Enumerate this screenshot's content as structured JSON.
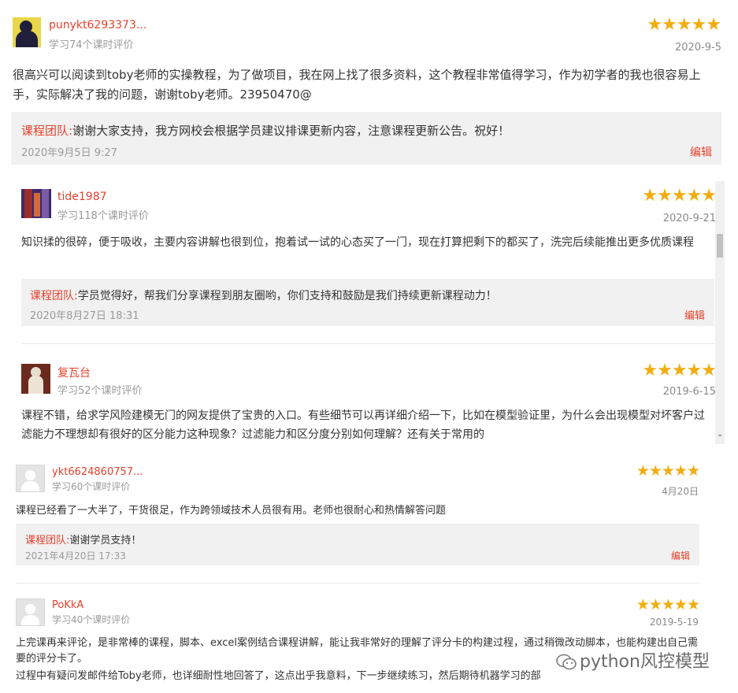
{
  "reviews": [
    {
      "user": "punykt6293373...",
      "meta": "学习74个课时评价",
      "stars": "★★★★★",
      "date": "2020-9-5",
      "content": "很高兴可以阅读到toby老师的实操教程，为了做项目，我在网上找了很多资料，这个教程非常值得学习，作为初学者的我也很容易上手，实际解决了我的问题，谢谢toby老师。23950470@",
      "reply": {
        "team": "课程团队",
        "text": "谢谢大家支持，我方网校会根据学员建议排课更新内容，注意课程更新公告。祝好！",
        "date": "2020年9月5日 9:27",
        "edit": "编辑"
      }
    },
    {
      "user": "tide1987",
      "meta": "学习118个课时评价",
      "stars": "★★★★★",
      "date": "2020-9-21",
      "content": "知识揉的很碎，便于吸收，主要内容讲解也很到位，抱着试一试的心态买了一门，现在打算把剩下的都买了，洗完后续能推出更多优质课程",
      "reply": {
        "team": "课程团队",
        "text": "学员觉得好，帮我们分享课程到朋友圈哟，你们支持和鼓励是我们持续更新课程动力！",
        "date": "2020年8月27日 18:31",
        "edit": "编辑"
      }
    },
    {
      "user": "复瓦台",
      "meta": "学习52个课时评价",
      "stars": "★★★★★",
      "date": "2019-6-15",
      "content": "课程不错，给求学风险建模无门的网友提供了宝贵的入口。有些细节可以再详细介绍一下，比如在模型验证里，为什么会出现模型对坏客户过滤能力不理想却有很好的区分能力这种现象？过滤能力和区分度分别如何理解？还有关于常用的"
    },
    {
      "user": "ykt6624860757...",
      "meta": "学习60个课时评价",
      "stars": "★★★★★",
      "date": "4月20日",
      "content": "课程已经看了一大半了，干货很足，作为跨领域技术人员很有用。老师也很耐心和热情解答问题",
      "reply": {
        "team": "课程团队",
        "text": "谢谢学员支持！",
        "date": "2021年4月20日 17:33",
        "edit": "编辑"
      }
    },
    {
      "user": "PoKkA",
      "meta": "学习40个课时评价",
      "stars": "★★★★★",
      "date": "2019-5-19",
      "content": "上完课再来评论，是非常棒的课程，脚本、excel案例结合课程讲解，能让我非常好的理解了评分卡的构建过程，通过稍微改动脚本，也能构建出自己需要的评分卡了。",
      "content2": "过程中有疑问发邮件给Toby老师，也详细耐性地回答了，这点出乎我意料，下一步继续练习，然后期待机器学习的部"
    }
  ],
  "watermark": "python风控模型",
  "colors": {
    "accent": "#e5412d",
    "star": "#f1ad0f",
    "reply_bg": "#f1f1f1"
  }
}
